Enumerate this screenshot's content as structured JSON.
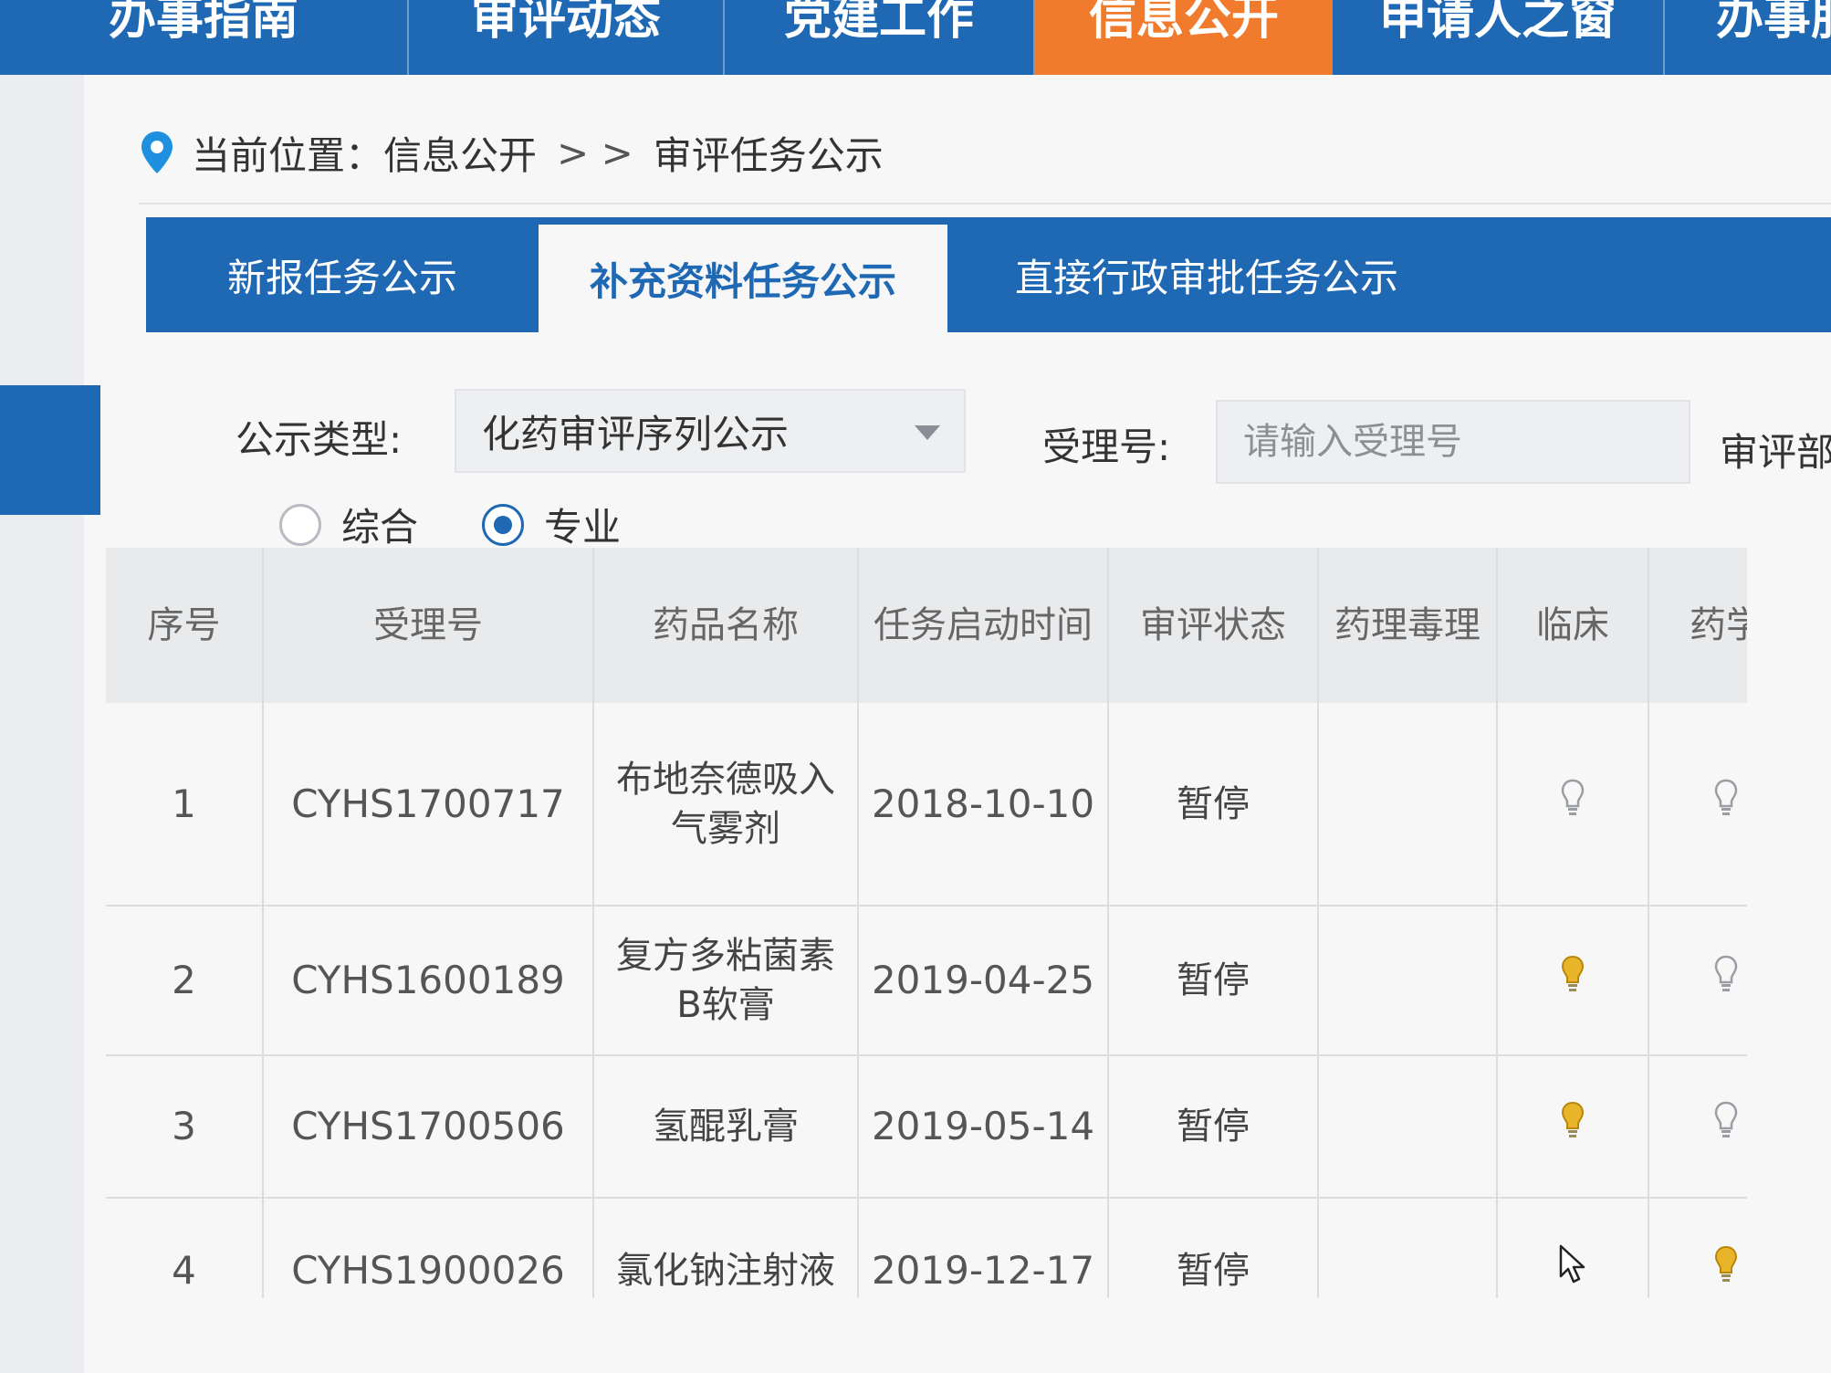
{
  "nav": {
    "items": [
      {
        "label": "办事指南"
      },
      {
        "label": "审评动态"
      },
      {
        "label": "党建工作"
      },
      {
        "label": "信息公开",
        "active": true
      },
      {
        "label": "申请人之窗"
      },
      {
        "label": "办事服务"
      }
    ]
  },
  "breadcrumb": {
    "prefix": "当前位置：",
    "section": "信息公开",
    "separator": "> >",
    "page": "审评任务公示"
  },
  "tabs": [
    {
      "label": "新报任务公示",
      "active": false
    },
    {
      "label": "补充资料任务公示",
      "active": true
    },
    {
      "label": "直接行政审批任务公示",
      "active": false
    }
  ],
  "filter": {
    "type_label": "公示类型:",
    "type_value": "化药审评序列公示",
    "accept_label": "受理号:",
    "accept_placeholder": "请输入受理号",
    "dept_label": "审评部门",
    "radios": [
      {
        "label": "综合",
        "checked": false
      },
      {
        "label": "专业",
        "checked": true
      }
    ]
  },
  "table": {
    "headers": [
      "序号",
      "受理号",
      "药品名称",
      "任务启动时间",
      "审评状态",
      "药理毒理",
      "临床",
      "药学"
    ],
    "rows": [
      {
        "no": "1",
        "accept_no": "CYHS1700717",
        "drug": "布地奈德吸入气雾剂",
        "start": "2018-10-10",
        "status": "暂停",
        "pharm_tox": "",
        "clinical": "gray",
        "pharmacy": "gray"
      },
      {
        "no": "2",
        "accept_no": "CYHS1600189",
        "drug": "复方多粘菌素B软膏",
        "start": "2019-04-25",
        "status": "暂停",
        "pharm_tox": "",
        "clinical": "yellow",
        "pharmacy": "gray"
      },
      {
        "no": "3",
        "accept_no": "CYHS1700506",
        "drug": "氢醌乳膏",
        "start": "2019-05-14",
        "status": "暂停",
        "pharm_tox": "",
        "clinical": "yellow",
        "pharmacy": "gray"
      },
      {
        "no": "4",
        "accept_no": "CYHS1900026",
        "drug": "氯化钠注射液",
        "start": "2019-12-17",
        "status": "暂停",
        "pharm_tox": "",
        "clinical": "cursor",
        "pharmacy": "yellow"
      }
    ]
  },
  "colors": {
    "brand_blue": "#1f68b3",
    "active_orange": "#f07b2c",
    "bulb_yellow": "#d9a51c",
    "bulb_gray": "#9a9ea4"
  }
}
